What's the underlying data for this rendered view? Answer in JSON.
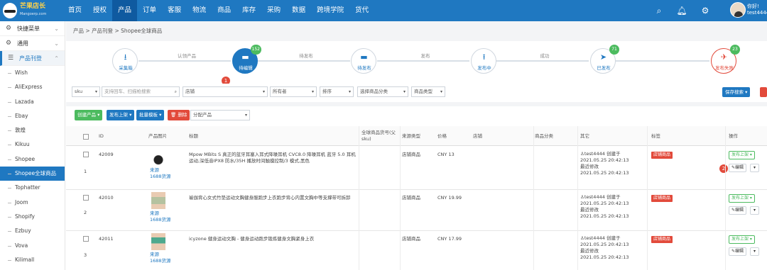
{
  "brand": {
    "name": "芒果店长",
    "sub": "Mangoerp.com"
  },
  "nav": [
    "首页",
    "授权",
    "产品",
    "订单",
    "客服",
    "物流",
    "商品",
    "库存",
    "采购",
    "数据",
    "跨境学院",
    "货代"
  ],
  "nav_active": 2,
  "user": {
    "greeting": "你好!",
    "name": "test4444"
  },
  "icons": {
    "search": "search-icon",
    "bell": "bell-icon",
    "settings": "gear-icon"
  },
  "sidebar": {
    "groups": [
      {
        "label": "快捷菜单",
        "icon": "gear-icon"
      },
      {
        "label": "通用",
        "icon": "gear-icon"
      },
      {
        "label": "产品刊登",
        "icon": "list-icon"
      }
    ],
    "items": [
      "Wish",
      "AliExpress",
      "Lazada",
      "Ebay",
      "敦煌",
      "Kikuu",
      "Shopee",
      "Shopee全球商品",
      "Tophatter",
      "Joom",
      "Shopify",
      "Ezbuy",
      "Vova",
      "Kilimall"
    ],
    "selected": 7
  },
  "breadcrumb": [
    "产品",
    "产品刊登",
    "Shopee全球商品"
  ],
  "steps": [
    {
      "label": "采集箱",
      "count": ""
    },
    {
      "label": "待编辑",
      "count": "152"
    },
    {
      "label": "待发布",
      "count": ""
    },
    {
      "label": "发布中",
      "count": ""
    },
    {
      "label": "已发布",
      "count": "71"
    },
    {
      "label": "发布失败",
      "count": "23"
    }
  ],
  "step_links": [
    "认领产品",
    "待发布",
    "发布",
    "成功"
  ],
  "filters": {
    "sku": "sku",
    "search_placeholder": "支持回车、扫描枪搜索",
    "shop": "店铺",
    "status": "所有者",
    "sort": "排序",
    "category": "选择商品分类",
    "type": "商品类型",
    "save_search": "保存搜索"
  },
  "toolbar": {
    "create": "创建产品",
    "publish": "发布上架",
    "batch": "批量模板",
    "delete": "删除",
    "assign": "分配产品"
  },
  "table": {
    "headers": [
      "ID",
      "产品图片",
      "标题",
      "全球商品货号(父sku)",
      "来源类型",
      "价格",
      "店铺",
      "商品分类",
      "其它",
      "标签",
      "操作"
    ],
    "rows": [
      {
        "no": "1",
        "id": "42009",
        "source": "来源",
        "src2": "1688货源",
        "title": "Mpow MBits S 真正的蓝牙耳塞入耳式降噪耳机 CVC8.0 降噪耳机 蓝牙 5.0 耳机运动,深低音IPX8 防水/35H 播放时间触摸控制/3 模式,黑色",
        "type": "店铺商品",
        "price": "CNY 13",
        "owner": "test4444",
        "created": "2021.05.25 20:42:13",
        "mod_label": "最近修改",
        "modified": "2021.05.25 20:42:13",
        "tag": "店铺商品",
        "action": "发布上架",
        "edit": "编辑",
        "created_label": "创建于"
      },
      {
        "no": "2",
        "id": "42010",
        "source": "来源",
        "src2": "1688货源",
        "title": "瑜伽背心女式竹垫运动文胸健身服跑步上衣跑步背心内置文胸中等支撑带可拆卸",
        "type": "店铺商品",
        "price": "CNY 19.99",
        "owner": "test4444",
        "created": "2021.05.25 20:42:13",
        "mod_label": "最近修改",
        "modified": "2021.05.25 20:42:13",
        "tag": "店铺商品",
        "action": "发布上架",
        "edit": "编辑",
        "created_label": "创建于"
      },
      {
        "no": "3",
        "id": "42011",
        "source": "来源",
        "src2": "1688货源",
        "title": "icyzone 健身运动文胸 - 健身运动跑步锻炼健身文胸紧身上衣",
        "type": "店铺商品",
        "price": "CNY 17.99",
        "owner": "test4444",
        "created": "2021.05.25 20:42:13",
        "mod_label": "最近修改",
        "modified": "2021.05.25 20:42:13",
        "tag": "店铺商品",
        "action": "发布上架",
        "edit": "编辑",
        "created_label": "创建于"
      }
    ]
  },
  "markers": [
    "1",
    "2"
  ],
  "colors": {
    "primary": "#1f78c1",
    "danger": "#e24a3b",
    "success": "#4cbb5f"
  }
}
